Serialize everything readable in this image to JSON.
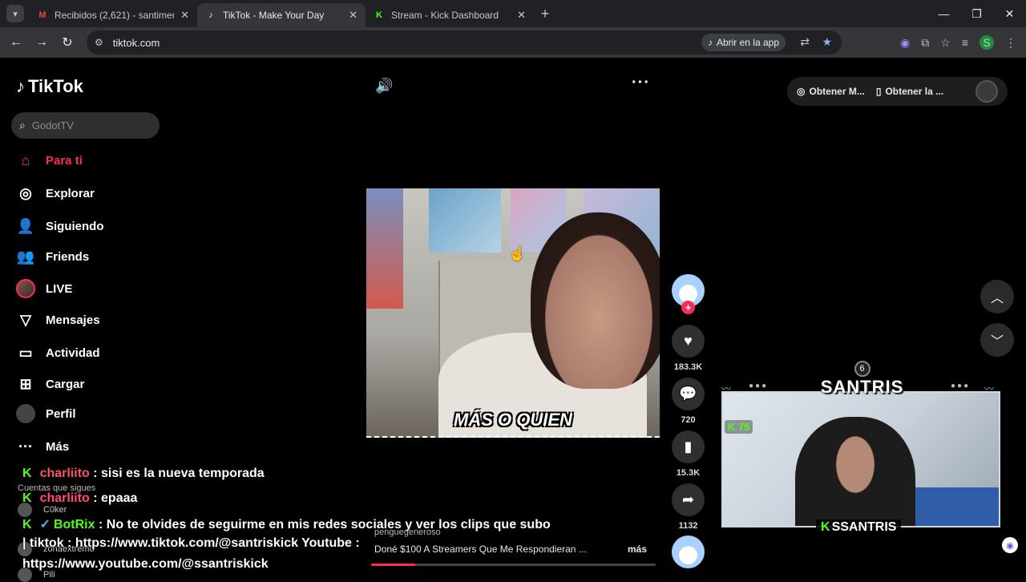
{
  "browser": {
    "tabs": [
      {
        "title": "Recibidos (2,621) - santimende",
        "favicon": "gmail-icon",
        "active": false
      },
      {
        "title": "TikTok - Make Your Day",
        "favicon": "tiktok-icon",
        "active": true
      },
      {
        "title": "Stream - Kick Dashboard",
        "favicon": "kick-icon",
        "active": false
      }
    ],
    "url": "tiktok.com",
    "open_app_label": "Abrir en la app",
    "profile_initial": "S"
  },
  "tiktok": {
    "logo": "TikTok",
    "search_placeholder": "GodotTV",
    "nav": [
      {
        "label": "Para ti",
        "icon": "home-icon",
        "active": true
      },
      {
        "label": "Explorar",
        "icon": "compass-icon"
      },
      {
        "label": "Siguiendo",
        "icon": "following-icon"
      },
      {
        "label": "Friends",
        "icon": "friends-icon"
      },
      {
        "label": "LIVE",
        "icon": "live-avatar-icon"
      },
      {
        "label": "Mensajes",
        "icon": "send-icon"
      },
      {
        "label": "Actividad",
        "icon": "activity-icon"
      },
      {
        "label": "Cargar",
        "icon": "upload-icon"
      },
      {
        "label": "Perfil",
        "icon": "profile-avatar-icon"
      },
      {
        "label": "Más",
        "icon": "more-icon"
      }
    ],
    "following_title": "Cuentas que sigues",
    "following_accounts": [
      "C0ker",
      "zonaextremo",
      "Pili"
    ],
    "top_right": {
      "item1": "Obtener M...",
      "item2": "Obtener la ..."
    },
    "video": {
      "caption": "MÁS O QUIEN",
      "author": "penguegeneroso",
      "description": "Doné $100 A Streamers Que Me Respondieran ...",
      "more": "más"
    },
    "actions": {
      "likes": "183.3K",
      "comments": "720",
      "saves": "15.3K",
      "shares": "1132"
    }
  },
  "chat": [
    {
      "user": "charliito",
      "message": ": sisi es la nueva temporada"
    },
    {
      "user": "charliito",
      "message": ": epaaa"
    },
    {
      "user": "BotRix",
      "message": ": No te olvides de seguirme en mis redes sociales y ver los clips que subo"
    },
    {
      "line": "| tiktok : https://www.tiktok.com/@santriskick Youtube :"
    },
    {
      "line": "https://www.youtube.com/@ssantriskick"
    }
  ],
  "stream_overlay": {
    "banner_name": "SANTRIS",
    "rank": "6",
    "kick_count": "75",
    "footer_name": "SSANTRIS",
    "kick_color": "#53fc18"
  }
}
